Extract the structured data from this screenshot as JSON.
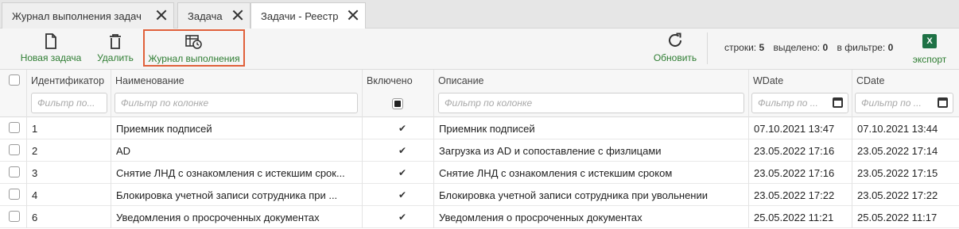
{
  "tabs": [
    {
      "label": "Журнал выполнения задач",
      "active": false
    },
    {
      "label": "Задача",
      "active": false
    },
    {
      "label": "Задачи - Реестр",
      "active": true
    }
  ],
  "toolbar": {
    "new_task": "Новая задача",
    "delete": "Удалить",
    "journal": "Журнал выполнения",
    "refresh": "Обновить",
    "export": "экспорт",
    "export_icon_text": "X",
    "rows_label": "строки:",
    "rows_value": "5",
    "selected_label": "выделено:",
    "selected_value": "0",
    "filter_label": "в фильтре:",
    "filter_value": "0",
    "accent_color": "#2e7d32",
    "highlight_color": "#e0603a"
  },
  "grid": {
    "columns": [
      "Идентификатор",
      "Наименование",
      "Включено",
      "Описание",
      "WDate",
      "CDate"
    ],
    "filters": {
      "id": "Фильтр по...",
      "name": "Фильтр по колонке",
      "description": "Фильтр по колонке",
      "wdate": "Фильтр по ...",
      "cdate": "Фильтр по ..."
    },
    "rows": [
      {
        "id": "1",
        "name": "Приемник подписей",
        "enabled": "✔",
        "description": "Приемник подписей",
        "wdate": "07.10.2021 13:47",
        "cdate": "07.10.2021 13:44"
      },
      {
        "id": "2",
        "name": "AD",
        "enabled": "✔",
        "description": "Загрузка из AD и сопоставление с физлицами",
        "wdate": "23.05.2022 17:16",
        "cdate": "23.05.2022 17:14"
      },
      {
        "id": "3",
        "name": "Снятие ЛНД с ознакомления с истекшим срок...",
        "enabled": "✔",
        "description": "Снятие ЛНД с ознакомления с истекшим сроком",
        "wdate": "23.05.2022 17:16",
        "cdate": "23.05.2022 17:15"
      },
      {
        "id": "4",
        "name": "Блокировка учетной записи сотрудника при ...",
        "enabled": "✔",
        "description": "Блокировка учетной записи сотрудника при увольнении",
        "wdate": "23.05.2022 17:22",
        "cdate": "23.05.2022 17:22"
      },
      {
        "id": "6",
        "name": "Уведомления о просроченных документах",
        "enabled": "✔",
        "description": "Уведомления о просроченных документах",
        "wdate": "25.05.2022 11:21",
        "cdate": "25.05.2022 11:17"
      }
    ]
  }
}
